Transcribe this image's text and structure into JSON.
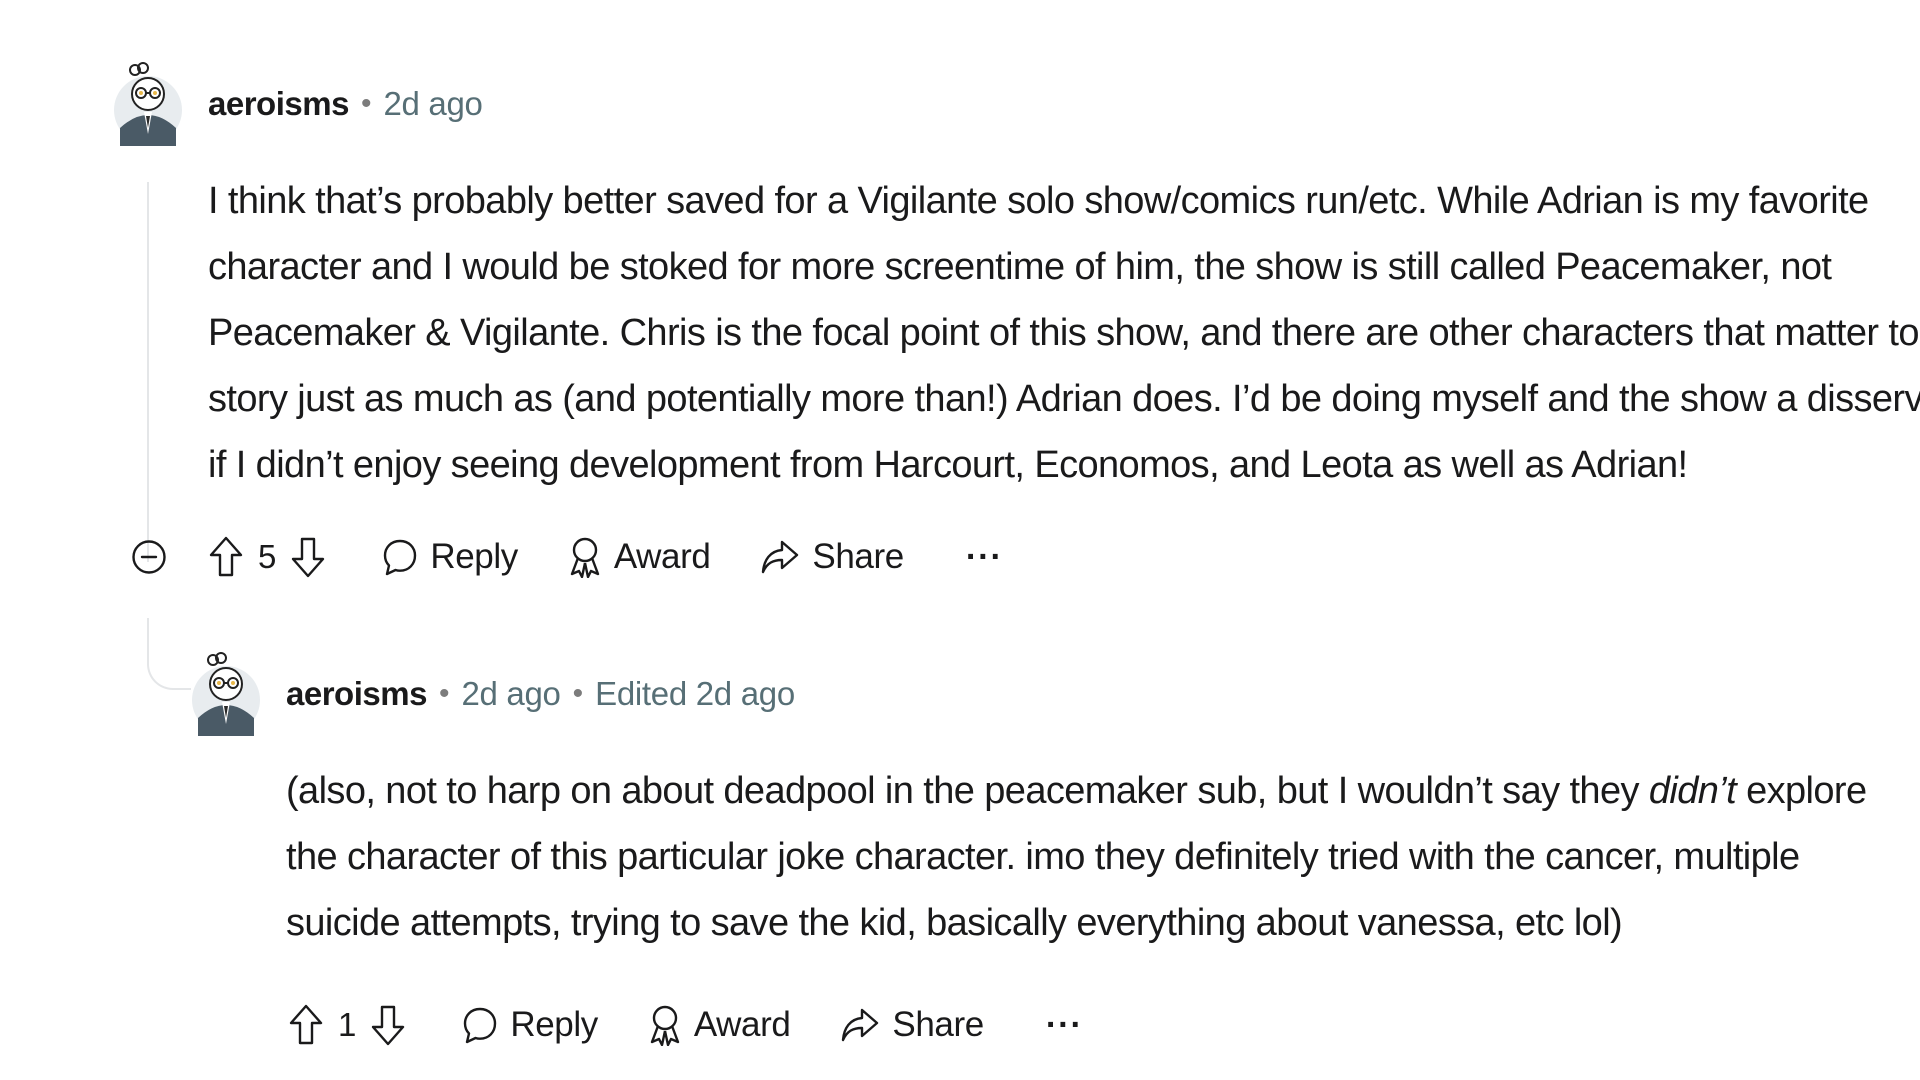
{
  "comments": [
    {
      "username": "aeroisms",
      "separator": "•",
      "time": "2d ago",
      "edited": "",
      "body": [
        {
          "text": "I think that’s probably better saved for a Vigilante solo show/comics run/etc. While Adrian is my favorite character and I would be stoked for more screentime of him, the show is still called Peacemaker, not Peacemaker & Vigilante. Chris is the focal point of this show, and there are other characters that matter to his story just as much as (and potentially more than!) Adrian does. I’d be doing myself and the show a disservice if I didn’t enjoy seeing development from Harcourt, Economos, and Leota as well as Adrian!"
        }
      ],
      "score": "5",
      "actions": {
        "reply": "Reply",
        "award": "Award",
        "share": "Share",
        "more": "···"
      }
    },
    {
      "username": "aeroisms",
      "separator": "•",
      "time": "2d ago",
      "edited": "Edited 2d ago",
      "body": [
        {
          "text": "(also, not to harp on about deadpool in the peacemaker sub, but I wouldn’t say they "
        },
        {
          "text": "didn’t",
          "italic": true
        },
        {
          "text": " explore the character of this particular joke character. imo they definitely tried with the cancer, multiple suicide attempts, trying to save the kid, basically everything about vanessa, etc lol)"
        }
      ],
      "score": "1",
      "actions": {
        "reply": "Reply",
        "award": "Award",
        "share": "Share",
        "more": "···"
      }
    }
  ],
  "icons": {
    "avatar": "snoo-avatar-icon",
    "collapse": "collapse-minus-icon",
    "upvote": "upvote-arrow-icon",
    "downvote": "downvote-arrow-icon",
    "reply": "speech-bubble-icon",
    "award": "award-ribbon-icon",
    "share": "share-arrow-icon"
  },
  "colors": {
    "text": "#1a1a1b",
    "meta": "#576f76",
    "thread_line": "#e4e6e8"
  }
}
